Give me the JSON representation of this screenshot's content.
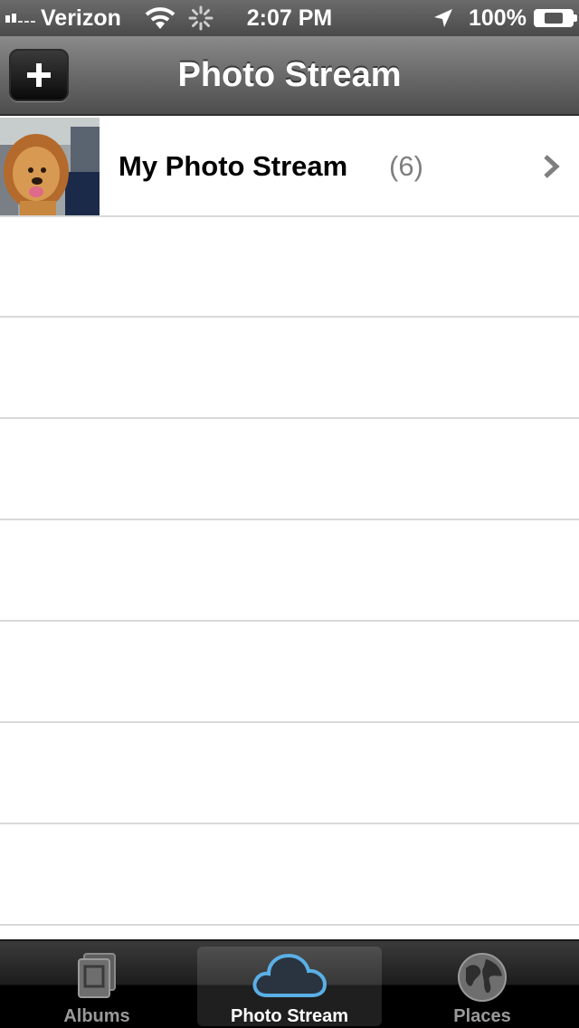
{
  "status_bar": {
    "carrier": "Verizon",
    "time": "2:07 PM",
    "battery": "100%"
  },
  "nav_bar": {
    "title": "Photo Stream",
    "add_button_label": "+"
  },
  "list": {
    "items": [
      {
        "title": "My Photo Stream",
        "count": "(6)"
      }
    ]
  },
  "tab_bar": {
    "tabs": [
      {
        "label": "Albums",
        "icon": "albums-icon",
        "selected": false
      },
      {
        "label": "Photo Stream",
        "icon": "cloud-icon",
        "selected": true
      },
      {
        "label": "Places",
        "icon": "globe-icon",
        "selected": false
      }
    ]
  },
  "colors": {
    "accent_cloud": "#5ab0e6",
    "count_gray": "#7f7f7f"
  }
}
